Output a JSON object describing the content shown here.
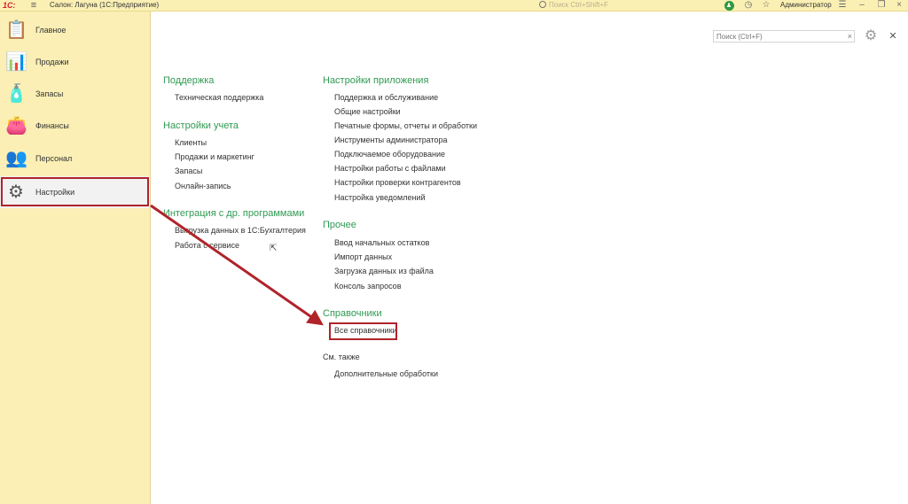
{
  "topbar": {
    "logo": "1С:",
    "app_title": "Салон: Лагуна  (1С:Предприятие)",
    "search_placeholder": "Поиск Ctrl+Shift+F",
    "user": "Администратор"
  },
  "sidebar": {
    "items": [
      {
        "label": "Главное",
        "icon": "clipboard-icon"
      },
      {
        "label": "Продажи",
        "icon": "sales-chart-icon"
      },
      {
        "label": "Запасы",
        "icon": "stock-icon"
      },
      {
        "label": "Финансы",
        "icon": "wallet-icon"
      },
      {
        "label": "Персонал",
        "icon": "people-icon"
      },
      {
        "label": "Настройки",
        "icon": "gear-icon"
      }
    ],
    "active_index": 5
  },
  "content": {
    "search_placeholder": "Поиск (Ctrl+F)",
    "left_column": [
      {
        "title": "Поддержка",
        "links": [
          "Техническая поддержка"
        ]
      },
      {
        "title": "Настройки учета",
        "links": [
          "Клиенты",
          "Продажи и маркетинг",
          "Запасы",
          "Онлайн-запись"
        ]
      },
      {
        "title": "Интеграция с др. программами",
        "links": [
          "Выгрузка данных в 1С:Бухгалтерия",
          "Работа с сервисе"
        ]
      }
    ],
    "right_column": [
      {
        "title": "Настройки приложения",
        "links": [
          "Поддержка и обслуживание",
          "Общие настройки",
          "Печатные формы, отчеты и обработки",
          "Инструменты администратора",
          "Подключаемое оборудование",
          "Настройки работы с файлами",
          "Настройки проверки контрагентов",
          "Настройка уведомлений"
        ]
      },
      {
        "title": "Прочее",
        "links": [
          "Ввод начальных остатков",
          "Импорт данных",
          "Загрузка данных из файла",
          "Консоль запросов"
        ]
      },
      {
        "title": "Справочники",
        "links": [
          "Все справочники"
        ]
      }
    ],
    "see_also": {
      "title": "См. также",
      "links": [
        "Дополнительные обработки"
      ]
    }
  },
  "colors": {
    "sidebar_bg": "#fbefb5",
    "section_title": "#2f9a52",
    "highlight": "#b0232a"
  }
}
